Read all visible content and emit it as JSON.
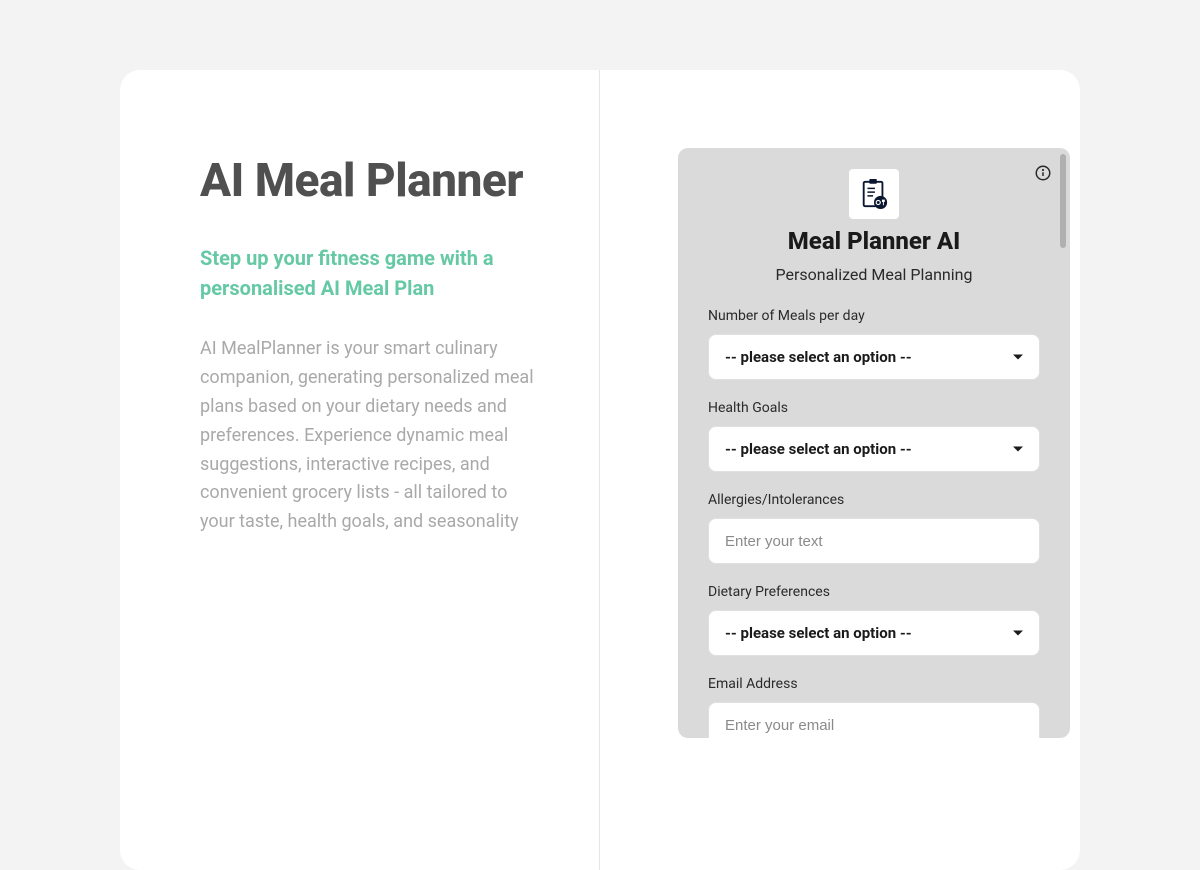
{
  "left": {
    "title": "AI Meal Planner",
    "subtitle": "Step up your fitness game with a personalised AI Meal Plan",
    "description": "AI MealPlanner is your smart culinary companion, generating personalized meal plans based on your dietary needs and preferences. Experience dynamic meal suggestions, interactive recipes, and convenient grocery lists - all tailored to your taste, health goals, and seasonality"
  },
  "widget": {
    "title": "Meal Planner AI",
    "subtitle": "Personalized Meal Planning",
    "select_placeholder": "-- please select an option --",
    "fields": {
      "meals_label": "Number of Meals per day",
      "goals_label": "Health Goals",
      "allergies_label": "Allergies/Intolerances",
      "allergies_placeholder": "Enter your text",
      "diet_label": "Dietary Preferences",
      "email_label": "Email Address",
      "email_placeholder": "Enter your email"
    }
  }
}
